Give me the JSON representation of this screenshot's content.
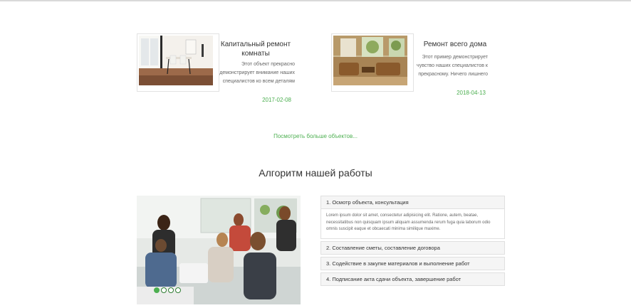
{
  "projects": [
    {
      "title": "Капитальный ремонт комнаты",
      "description": "Этот объект прекрасно демонстрирует внимание наших специалистов ко всем деталям",
      "date": "2017-02-08"
    },
    {
      "title": "Ремонт всего дома",
      "description": "Этот пример демонстрирует чувство наших специалистов к прекрасному. Ничего лишнего",
      "date": "2018-04-13"
    }
  ],
  "more_link": "Посмотреть больше объектов...",
  "section_title": "Алгоритм нашей работы",
  "slider": {
    "dots_count": 4,
    "active_index": 0
  },
  "steps": [
    {
      "label": "1. Осмотр объекта, консультация",
      "body": "Lorem ipsum dolor sit amet, consectetur adipisicing elit. Ratione, autem, beatae, necessitatibus non quisquam ipsum aliquam assumenda rerum fuga quia laborum odio omnis suscipit eaque et obcaecati minima similique maxime.",
      "expanded": true
    },
    {
      "label": "2. Составление сметы, составление договора",
      "expanded": false
    },
    {
      "label": "3. Содействие в закупке материалов и выполнение работ",
      "expanded": false
    },
    {
      "label": "4. Подписание акта сдачи объекта, завершение работ",
      "expanded": false
    }
  ],
  "colors": {
    "accent": "#4caf50",
    "text": "#333333",
    "muted": "#666666",
    "panel": "#f5f5f5"
  }
}
